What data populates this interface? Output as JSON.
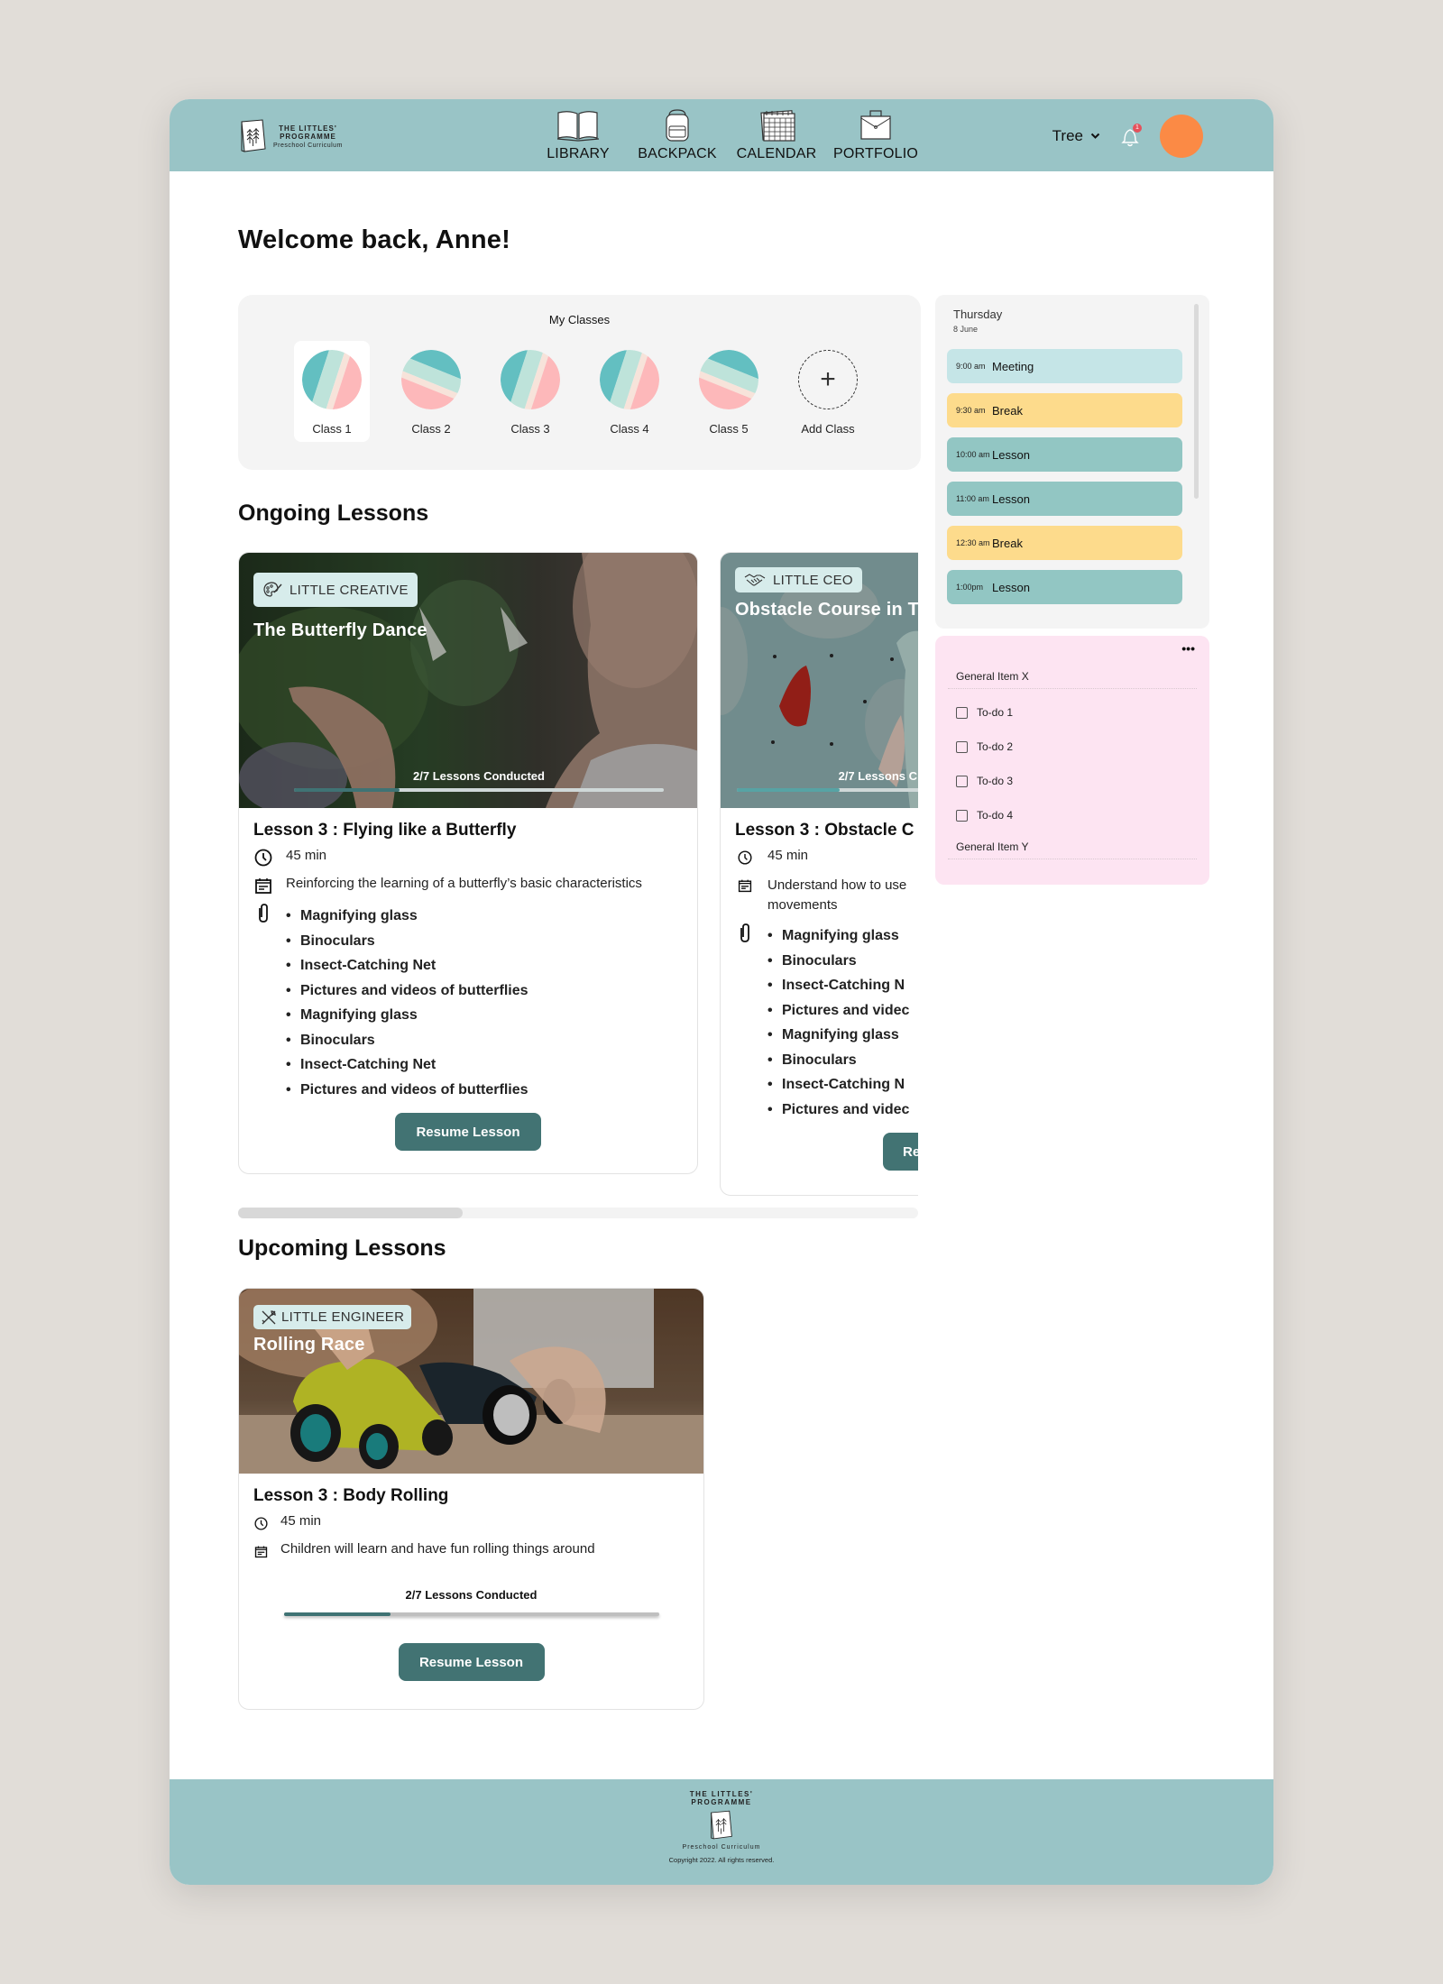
{
  "brand": {
    "line1": "THE LITTLES'",
    "line2": "PROGRAMME",
    "tagline": "Preschool Curriculum"
  },
  "nav": [
    {
      "label": "LIBRARY",
      "icon": "book-icon"
    },
    {
      "label": "BACKPACK",
      "icon": "backpack-icon"
    },
    {
      "label": "CALENDAR",
      "icon": "calendar-icon"
    },
    {
      "label": "PORTFOLIO",
      "icon": "briefcase-icon"
    }
  ],
  "header": {
    "tree_select": "Tree",
    "notification_count": "1",
    "avatar_color": "#fb8a45"
  },
  "welcome": "Welcome back, Anne!",
  "my_classes": {
    "title": "My Classes",
    "items": [
      {
        "label": "Class 1",
        "active": true
      },
      {
        "label": "Class 2",
        "active": false
      },
      {
        "label": "Class 3",
        "active": false
      },
      {
        "label": "Class 4",
        "active": false
      },
      {
        "label": "Class 5",
        "active": false
      }
    ],
    "add_label": "Add Class"
  },
  "ongoing": {
    "title": "Ongoing Lessons",
    "cards": [
      {
        "tag": "LITTLE CREATIVE",
        "tag_icon": "palette-icon",
        "unit_title": "The Butterfly Dance",
        "progress_label": "2/7 Lessons Conducted",
        "progress": 0.2857,
        "lesson_title": "Lesson 3 : Flying like a Butterfly",
        "duration": "45 min",
        "description": "Reinforcing the learning of a butterfly’s basic characteristics",
        "materials": [
          "Magnifying glass",
          "Binoculars",
          "Insect-Catching Net",
          "Pictures and videos of butterflies",
          "Magnifying glass",
          "Binoculars",
          "Insect-Catching Net",
          "Pictures and videos of butterflies"
        ],
        "button": "Resume Lesson"
      },
      {
        "tag": "LITTLE CEO",
        "tag_icon": "handshake-icon",
        "unit_title": "Obstacle Course in T",
        "progress_label": "2/7 Lessons C",
        "progress": 0.2857,
        "lesson_title": "Lesson 3 : Obstacle C",
        "duration": "45 min",
        "description": "Understand how to use movements",
        "materials": [
          "Magnifying glass",
          "Binoculars",
          "Insect-Catching N",
          "Pictures and videc",
          "Magnifying glass",
          "Binoculars",
          "Insect-Catching N",
          "Pictures and videc"
        ],
        "button": "Re"
      }
    ],
    "scroll_position": 0.33
  },
  "upcoming": {
    "title": "Upcoming Lessons",
    "cards": [
      {
        "tag": "LITTLE ENGINEER",
        "tag_icon": "tools-icon",
        "unit_title": "Rolling Race",
        "lesson_title": "Lesson 3 : Body Rolling",
        "duration": "45 min",
        "description": "Children will learn and have fun rolling things around",
        "progress_label": "2/7 Lessons Conducted",
        "progress": 0.2857,
        "button": "Resume Lesson"
      }
    ]
  },
  "schedule": {
    "day": "Thursday",
    "date": "8 June",
    "items": [
      {
        "time": "9:00 am",
        "name": "Meeting",
        "color": "#c5e5e7"
      },
      {
        "time": "9:30 am",
        "name": "Break",
        "color": "#fddb8c"
      },
      {
        "time": "10:00 am",
        "name": "Lesson",
        "color": "#92c6c3"
      },
      {
        "time": "11:00 am",
        "name": "Lesson",
        "color": "#92c6c3"
      },
      {
        "time": "12:30 am",
        "name": "Break",
        "color": "#fddb8c"
      },
      {
        "time": "1:00pm",
        "name": "Lesson",
        "color": "#92c6c3"
      }
    ]
  },
  "todo": {
    "more": "•••",
    "group_x": "General Item X",
    "items": [
      "To-do 1",
      "To-do 2",
      "To-do 3",
      "To-do 4"
    ],
    "group_y": "General Item Y"
  },
  "footer": {
    "line1": "THE LITTLES'",
    "line2": "PROGRAMME",
    "tagline": "Preschool Curriculum",
    "copyright": "Copyright 2022. All rights reserved."
  },
  "colors": {
    "header_bg": "#99c4c6",
    "accent": "#427373",
    "tag_bg": "#d7eceb",
    "todo_bg": "#fde4f2"
  }
}
